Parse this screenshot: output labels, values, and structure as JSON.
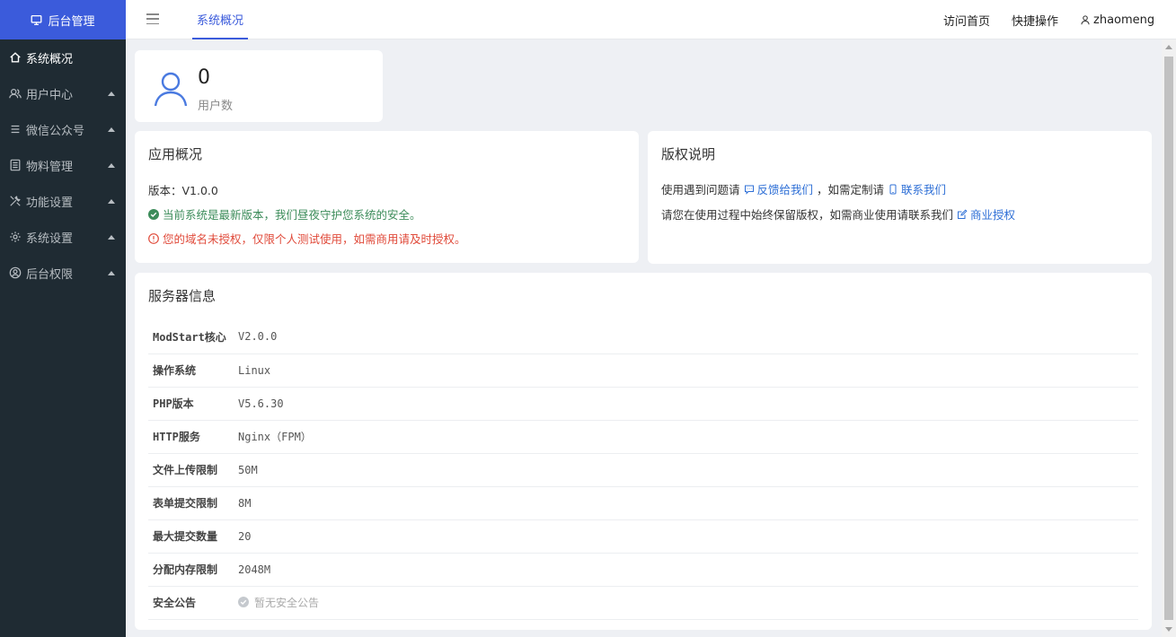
{
  "brand": {
    "label": "后台管理",
    "icon": "monitor-icon",
    "bg": "#3b5bdb"
  },
  "sidebar": {
    "items": [
      {
        "label": "系统概况",
        "icon": "home-icon",
        "active": true
      },
      {
        "label": "用户中心",
        "icon": "users-icon"
      },
      {
        "label": "微信公众号",
        "icon": "list-icon"
      },
      {
        "label": "物料管理",
        "icon": "document-icon"
      },
      {
        "label": "功能设置",
        "icon": "tools-icon"
      },
      {
        "label": "系统设置",
        "icon": "gear-icon"
      },
      {
        "label": "后台权限",
        "icon": "user-circle-icon"
      }
    ]
  },
  "header": {
    "tab": "系统概况",
    "home_link": "访问首页",
    "quick_actions": "快捷操作",
    "username": "zhaomeng"
  },
  "stat": {
    "value": "0",
    "label": "用户数"
  },
  "app_overview": {
    "title": "应用概况",
    "version": "版本：V1.0.0",
    "status_ok": "当前系统是最新版本，我们昼夜守护您系统的安全。",
    "status_warn": "您的域名未授权，仅限个人测试使用，如需商用请及时授权。"
  },
  "copyright": {
    "title": "版权说明",
    "line1_prefix": "使用遇到问题请",
    "feedback_link": "反馈给我们",
    "line1_mid": "，如需定制请",
    "contact_link": "联系我们",
    "line2_prefix": "请您在使用过程中始终保留版权，如需商业使用请联系我们",
    "license_link": "商业授权"
  },
  "server": {
    "title": "服务器信息",
    "rows": [
      {
        "key": "ModStart核心",
        "value": "V2.0.0"
      },
      {
        "key": "操作系统",
        "value": "Linux"
      },
      {
        "key": "PHP版本",
        "value": "V5.6.30"
      },
      {
        "key": "HTTP服务",
        "value": "Nginx（FPM）"
      },
      {
        "key": "文件上传限制",
        "value": "50M"
      },
      {
        "key": "表单提交限制",
        "value": "8M"
      },
      {
        "key": "最大提交数量",
        "value": "20"
      },
      {
        "key": "分配内存限制",
        "value": "2048M"
      },
      {
        "key": "安全公告",
        "value": "暂无安全公告"
      }
    ]
  },
  "colors": {
    "accent": "#3b5bdb",
    "link": "#2e6fd6",
    "ok": "#3c8c5a",
    "warn": "#e04a3a",
    "sidebar": "#1f2b33"
  }
}
